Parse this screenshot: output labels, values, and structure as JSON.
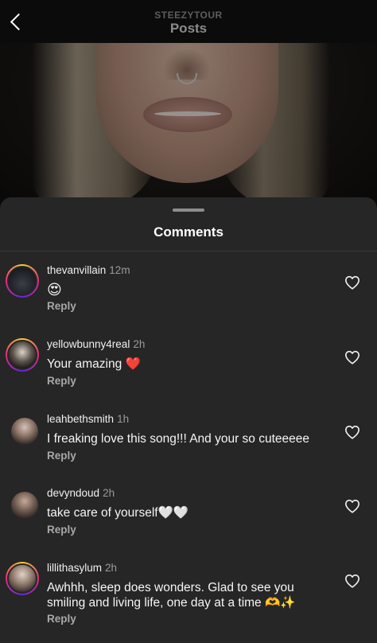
{
  "header": {
    "account": "STEEZYTOUR",
    "title": "Posts"
  },
  "sheet": {
    "title": "Comments"
  },
  "comments": [
    {
      "user": "thevanvillain",
      "time": "12m",
      "text": "😍",
      "reply": "Reply"
    },
    {
      "user": "yellowbunny4real",
      "time": "2h",
      "text": "Your amazing ❤️",
      "reply": "Reply"
    },
    {
      "user": "leahbethsmith",
      "time": "1h",
      "text": "I freaking love this song!!! And your so cuteeeee",
      "reply": "Reply"
    },
    {
      "user": "devyndoud",
      "time": "2h",
      "text": "take care of yourself🤍🤍",
      "reply": "Reply"
    },
    {
      "user": "lillithasylum",
      "time": "2h",
      "text": "Awhhh, sleep does wonders. Glad to see you smiling and living life, one day at a time 🫶✨",
      "reply": "Reply"
    }
  ],
  "icons": {
    "back": "chevron-left-icon",
    "like": "heart-outline-icon"
  },
  "colors": {
    "background": "#262626",
    "header": "#0b0b0b",
    "text": "#f5f5f5",
    "muted": "#a8a8a8",
    "story_ring": [
      "#f9ce34",
      "#ee2a7b",
      "#6228d7"
    ]
  }
}
